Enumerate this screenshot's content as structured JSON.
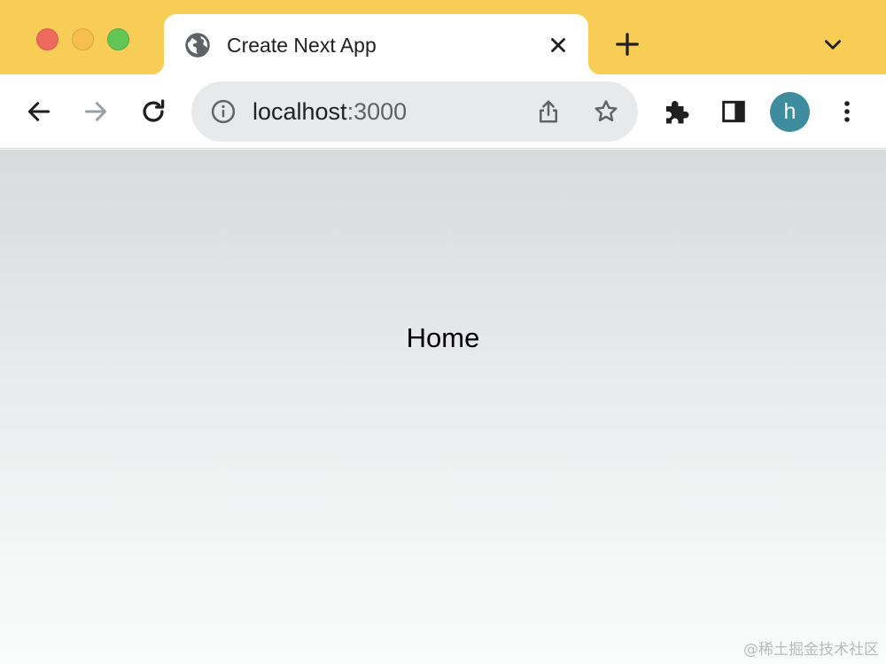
{
  "window": {
    "traffic_lights": {
      "close": "#ee6a5f",
      "minimize": "#f5be4f",
      "maximize": "#62c554"
    },
    "tab_strip_color": "#f7cd56"
  },
  "tab": {
    "title": "Create Next App",
    "favicon": "globe-icon",
    "close_icon": "close-icon"
  },
  "toolbar": {
    "back_icon": "arrow-left-icon",
    "forward_icon": "arrow-right-icon",
    "reload_icon": "reload-icon",
    "address": {
      "host": "localhost",
      "port": ":3000",
      "info_icon": "info-icon",
      "share_icon": "share-icon",
      "bookmark_icon": "star-icon"
    },
    "extensions_icon": "puzzle-icon",
    "side_panel_icon": "side-panel-icon",
    "profile": {
      "initial": "h",
      "color": "#3d8d9e"
    },
    "menu_icon": "more-vert-icon"
  },
  "page": {
    "heading": "Home"
  },
  "watermark": "@稀土掘金技术社区"
}
